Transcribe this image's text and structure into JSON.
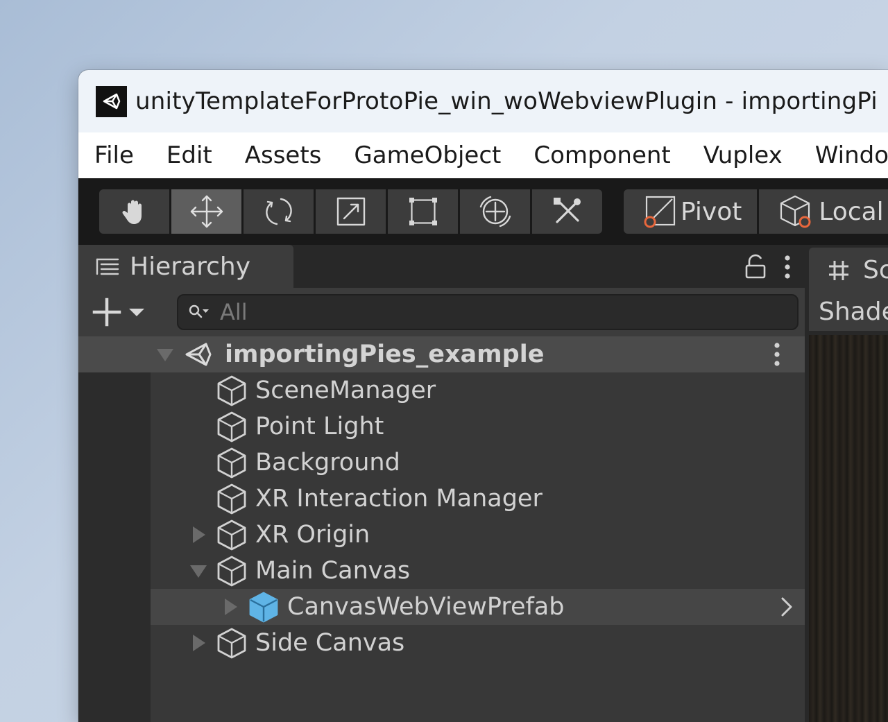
{
  "window": {
    "title": "unityTemplateForProtoPie_win_woWebviewPlugin - importingPi"
  },
  "menu": [
    "File",
    "Edit",
    "Assets",
    "GameObject",
    "Component",
    "Vuplex",
    "Windo"
  ],
  "toolbar": {
    "tools": [
      "hand-icon",
      "move-icon",
      "rotate-icon",
      "scale-icon",
      "rect-transform-icon",
      "transform-icon",
      "custom-tool-icon"
    ],
    "active_tool": "move-icon",
    "pivot_label": "Pivot",
    "local_label": "Local"
  },
  "hierarchy": {
    "tab_label": "Hierarchy",
    "search_placeholder": "All",
    "scene_name": "importingPies_example",
    "items": [
      {
        "label": "SceneManager",
        "expand": "none",
        "indent": 1,
        "prefab": false
      },
      {
        "label": "Point Light",
        "expand": "none",
        "indent": 1,
        "prefab": false
      },
      {
        "label": "Background",
        "expand": "none",
        "indent": 1,
        "prefab": false
      },
      {
        "label": "XR Interaction Manager",
        "expand": "none",
        "indent": 1,
        "prefab": false
      },
      {
        "label": "XR Origin",
        "expand": "collapsed",
        "indent": 1,
        "prefab": false
      },
      {
        "label": "Main Canvas",
        "expand": "expanded",
        "indent": 1,
        "prefab": false
      },
      {
        "label": "CanvasWebViewPrefab",
        "expand": "collapsed",
        "indent": 2,
        "prefab": true,
        "selected": true
      },
      {
        "label": "Side Canvas",
        "expand": "collapsed",
        "indent": 1,
        "prefab": false
      }
    ]
  },
  "scene_panel": {
    "tab_label": "Sc",
    "shading_label": "Shade"
  },
  "colors": {
    "prefab_icon": "#5fb4e6",
    "gizmo_orange": "#e8673c"
  }
}
